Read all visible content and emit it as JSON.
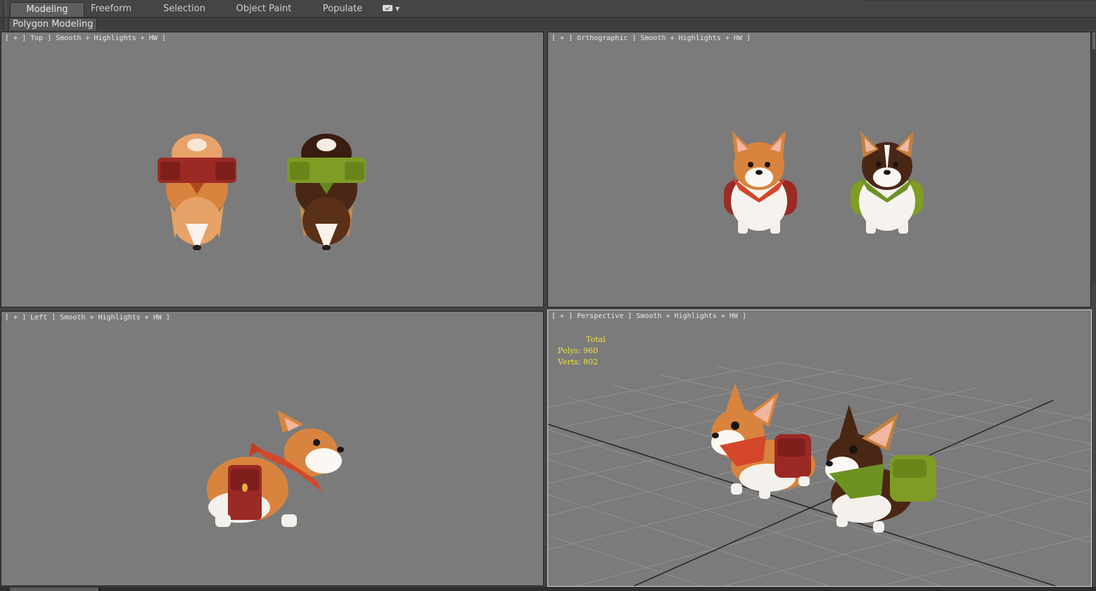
{
  "ribbon": {
    "tabs": [
      {
        "label": "Modeling",
        "active": true
      },
      {
        "label": "Freeform",
        "active": false
      },
      {
        "label": "Selection",
        "active": false
      },
      {
        "label": "Object Paint",
        "active": false
      },
      {
        "label": "Populate",
        "active": false
      }
    ],
    "extra_icon": "display-toggle-icon",
    "panel_label": "Polygon Modeling"
  },
  "viewports": {
    "top": {
      "label": "[ + ] Top ] Smooth + Highlights + HW ]"
    },
    "ortho": {
      "label": "[ + ] Orthographic ] Smooth + Highlights + HW ]"
    },
    "left": {
      "label": "[ + ] Left ] Smooth + Highlights + HW ]"
    },
    "persp": {
      "label": "[ + ] Perspective ] Smooth + Highlights + HW ]"
    }
  },
  "stats": {
    "title": "Total",
    "polys": "Polys: 960",
    "verts": "Verts: 802"
  },
  "colors": {
    "viewport_bg": "#7b7b7b",
    "stats_text": "#f0e13c",
    "corgi_orange": "#d9843e",
    "corgi_brown": "#4a2614",
    "bag_red": "#9b2a24",
    "bag_green": "#7f9c24",
    "scarf_red": "#d4472a",
    "scarf_green": "#6d9222"
  }
}
